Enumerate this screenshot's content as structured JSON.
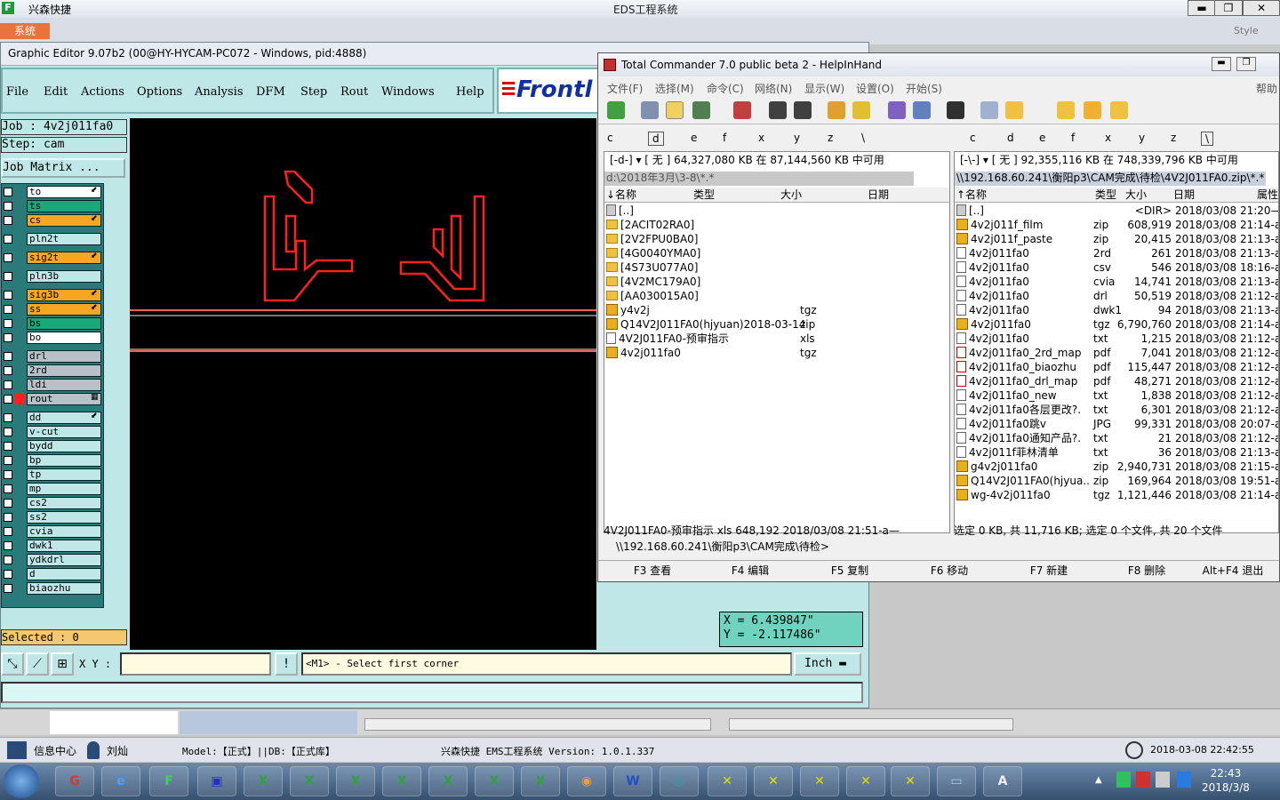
{
  "ems": {
    "app_name": "兴森快捷",
    "logo_letter": "F",
    "center_title": "EDS工程系统",
    "sys_tab": "系统",
    "style_label": "Style",
    "min": "▬",
    "max": "❐",
    "close": "✕"
  },
  "editor": {
    "title": "Graphic Editor 9.07b2 (00@HY-HYCAM-PC072 - Windows, pid:4888)",
    "menu": [
      "File",
      "Edit",
      "Actions",
      "Options",
      "Analysis",
      "DFM",
      "Step",
      "Rout",
      "Windows",
      "Help"
    ],
    "brand": "Frontl",
    "job": "Job : 4v2j011fa0",
    "step": "Step: cam",
    "job_matrix": "Job Matrix ...",
    "layers": [
      {
        "name": "to",
        "color": "#ffffff",
        "mark": "⬋"
      },
      {
        "name": "ts",
        "color": "#1aa87a",
        "mark": ""
      },
      {
        "name": "cs",
        "color": "#f5a623",
        "mark": "⬋"
      },
      {
        "name": "pln2t",
        "color": "#bfe7e7",
        "mark": ""
      },
      {
        "name": "sig2t",
        "color": "#f5a623",
        "mark": "⬋"
      },
      {
        "name": "pln3b",
        "color": "#bfe7e7",
        "mark": ""
      },
      {
        "name": "sig3b",
        "color": "#f5a623",
        "mark": "⬋"
      },
      {
        "name": "ss",
        "color": "#f5a623",
        "mark": "⬋"
      },
      {
        "name": "bs",
        "color": "#1aa87a",
        "mark": ""
      },
      {
        "name": "bo",
        "color": "#ffffff",
        "mark": ""
      },
      {
        "name": "drl",
        "color": "#b8c0c8",
        "mark": ""
      },
      {
        "name": "2rd",
        "color": "#b8c0c8",
        "mark": ""
      },
      {
        "name": "ldi",
        "color": "#b8c0c8",
        "mark": ""
      },
      {
        "name": "rout",
        "color": "#b8c0c8",
        "mark": "▦"
      },
      {
        "name": "dd",
        "color": "#bfe7e7",
        "mark": "⬋"
      },
      {
        "name": "v-cut",
        "color": "#bfe7e7",
        "mark": ""
      },
      {
        "name": "bydd",
        "color": "#bfe7e7",
        "mark": ""
      },
      {
        "name": "bp",
        "color": "#bfe7e7",
        "mark": ""
      },
      {
        "name": "tp",
        "color": "#bfe7e7",
        "mark": ""
      },
      {
        "name": "mp",
        "color": "#bfe7e7",
        "mark": ""
      },
      {
        "name": "cs2",
        "color": "#bfe7e7",
        "mark": ""
      },
      {
        "name": "ss2",
        "color": "#bfe7e7",
        "mark": ""
      },
      {
        "name": "cvia",
        "color": "#bfe7e7",
        "mark": ""
      },
      {
        "name": "dwk1",
        "color": "#bfe7e7",
        "mark": ""
      },
      {
        "name": "ydkdrl",
        "color": "#bfe7e7",
        "mark": ""
      },
      {
        "name": "d",
        "color": "#bfe7e7",
        "mark": ""
      },
      {
        "name": "biaozhu",
        "color": "#bfe7e7",
        "mark": ""
      }
    ],
    "selected": "Selected : 0",
    "coord_x": "X =  6.439847\"",
    "coord_y": "Y = -2.117486\"",
    "xy_label": "X Y :",
    "xy_value": "",
    "prompt": "<M1> - Select first corner",
    "units": "Inch"
  },
  "tc": {
    "title": "Total Commander 7.0 public beta 2 - HelpInHand",
    "menu": [
      "文件(F)",
      "选择(M)",
      "命令(C)",
      "网络(N)",
      "显示(W)",
      "设置(O)",
      "开始(S)"
    ],
    "help": "帮助",
    "left_drives": [
      "c",
      "d",
      "e",
      "f",
      "x",
      "y",
      "z",
      "\\"
    ],
    "right_drives": [
      "c",
      "d",
      "e",
      "f",
      "x",
      "y",
      "z",
      "\\"
    ],
    "left_info": "[-d-]  ▾  [ 无 ]  64,327,080 KB 在 87,144,560 KB 中可用",
    "right_info": "[-\\-]  ▾  [ 无 ]  92,355,116 KB 在 748,339,796 KB 中可用",
    "left_path": "d:\\2018年3月\\3-8\\*.*",
    "right_path": "\\\\192.168.60.241\\衡阳p3\\CAM完成\\待检\\4V2J011FA0.zip\\*.*",
    "left_cols": [
      "↓名称",
      "类型",
      "大小",
      "日期"
    ],
    "right_cols": [
      "↑名称",
      "类型",
      "大小",
      "日期",
      "属性"
    ],
    "left_files": [
      {
        "name": "[..]",
        "type": "",
        "icon": "up"
      },
      {
        "name": "[2ACIT02RA0]",
        "type": "",
        "icon": "folder"
      },
      {
        "name": "[2V2FPU0BA0]",
        "type": "",
        "icon": "folder"
      },
      {
        "name": "[4G0040YMA0]",
        "type": "",
        "icon": "folder"
      },
      {
        "name": "[4S73U077A0]",
        "type": "",
        "icon": "folder"
      },
      {
        "name": "[4V2MC179A0]",
        "type": "",
        "icon": "folder"
      },
      {
        "name": "[AA030015A0]",
        "type": "",
        "icon": "folder"
      },
      {
        "name": "y4v2j",
        "type": "tgz",
        "icon": "zip"
      },
      {
        "name": "Q14V2J011FA0(hjyuan)2018-03-14",
        "type": "zip",
        "icon": "zip"
      },
      {
        "name": "4V2J011FA0-预审指示",
        "type": "xls",
        "icon": "file"
      },
      {
        "name": "4v2j011fa0",
        "type": "tgz",
        "icon": "zip"
      }
    ],
    "right_files": [
      {
        "name": "[..]",
        "type": "",
        "size": "<DIR>",
        "date": "2018/03/08 21:20—",
        "icon": "up"
      },
      {
        "name": "4v2j011f_film",
        "type": "zip",
        "size": "608,919",
        "date": "2018/03/08 21:14-a—",
        "icon": "zip"
      },
      {
        "name": "4v2j011f_paste",
        "type": "zip",
        "size": "20,415",
        "date": "2018/03/08 21:13-a—",
        "icon": "zip"
      },
      {
        "name": "4v2j011fa0",
        "type": "2rd",
        "size": "261",
        "date": "2018/03/08 21:13-a—",
        "icon": "file"
      },
      {
        "name": "4v2j011fa0",
        "type": "csv",
        "size": "546",
        "date": "2018/03/08 18:16-a—",
        "icon": "file"
      },
      {
        "name": "4v2j011fa0",
        "type": "cvia",
        "size": "14,741",
        "date": "2018/03/08 21:13-a—",
        "icon": "file"
      },
      {
        "name": "4v2j011fa0",
        "type": "drl",
        "size": "50,519",
        "date": "2018/03/08 21:12-a—",
        "icon": "file"
      },
      {
        "name": "4v2j011fa0",
        "type": "dwk1",
        "size": "94",
        "date": "2018/03/08 21:13-a—",
        "icon": "file"
      },
      {
        "name": "4v2j011fa0",
        "type": "tgz",
        "size": "6,790,760",
        "date": "2018/03/08 21:14-a—",
        "icon": "zip"
      },
      {
        "name": "4v2j011fa0",
        "type": "txt",
        "size": "1,215",
        "date": "2018/03/08 21:12-a—",
        "icon": "file"
      },
      {
        "name": "4v2j011fa0_2rd_map",
        "type": "pdf",
        "size": "7,041",
        "date": "2018/03/08 21:12-a—",
        "icon": "pdf"
      },
      {
        "name": "4v2j011fa0_biaozhu",
        "type": "pdf",
        "size": "115,447",
        "date": "2018/03/08 21:12-a—",
        "icon": "pdf"
      },
      {
        "name": "4v2j011fa0_drl_map",
        "type": "pdf",
        "size": "48,271",
        "date": "2018/03/08 21:12-a—",
        "icon": "pdf"
      },
      {
        "name": "4v2j011fa0_new",
        "type": "txt",
        "size": "1,838",
        "date": "2018/03/08 21:12-a—",
        "icon": "file"
      },
      {
        "name": "4v2j011fa0各层更改?.",
        "type": "txt",
        "size": "6,301",
        "date": "2018/03/08 21:12-a—",
        "icon": "file"
      },
      {
        "name": "4v2j011fa0跳v",
        "type": "JPG",
        "size": "99,331",
        "date": "2018/03/08 20:07-a—",
        "icon": "file"
      },
      {
        "name": "4v2j011fa0通知产品?.",
        "type": "txt",
        "size": "21",
        "date": "2018/03/08 21:12-a—",
        "icon": "file"
      },
      {
        "name": "4v2j011f菲林清单",
        "type": "txt",
        "size": "36",
        "date": "2018/03/08 21:13-a—",
        "icon": "file"
      },
      {
        "name": "g4v2j011fa0",
        "type": "zip",
        "size": "2,940,731",
        "date": "2018/03/08 21:15-a—",
        "icon": "zip"
      },
      {
        "name": "Q14V2J011FA0(hjyua..",
        "type": "zip",
        "size": "169,964",
        "date": "2018/03/08 19:51-a—",
        "icon": "zip"
      },
      {
        "name": "wg-4v2j011fa0",
        "type": "tgz",
        "size": "1,121,446",
        "date": "2018/03/08 21:14-a—",
        "icon": "zip"
      }
    ],
    "left_status": "4V2J011FA0-预审指示         xls        648,192  2018/03/08  21:51-a—",
    "right_status": "选定 0 KB, 共 11,716 KB; 选定 0 个文件, 共 20 个文件",
    "cmd_path": "\\\\192.168.60.241\\衡阳p3\\CAM完成\\待检>",
    "fkeys": [
      "F3 查看",
      "F4 编辑",
      "F5 复制",
      "F6 移动",
      "F7 新建",
      "F8 删除",
      "Alt+F4 退出"
    ]
  },
  "ems_status": {
    "info_center": "信息中心",
    "user": "刘灿",
    "model": "Model:【正式】||DB:【正式库】",
    "version": "兴森快捷  EMS工程系统  Version: 1.0.1.337",
    "datetime": "2018-03-08 22:42:55"
  },
  "taskbar": {
    "time": "22:43",
    "date": "2018/3/8"
  }
}
